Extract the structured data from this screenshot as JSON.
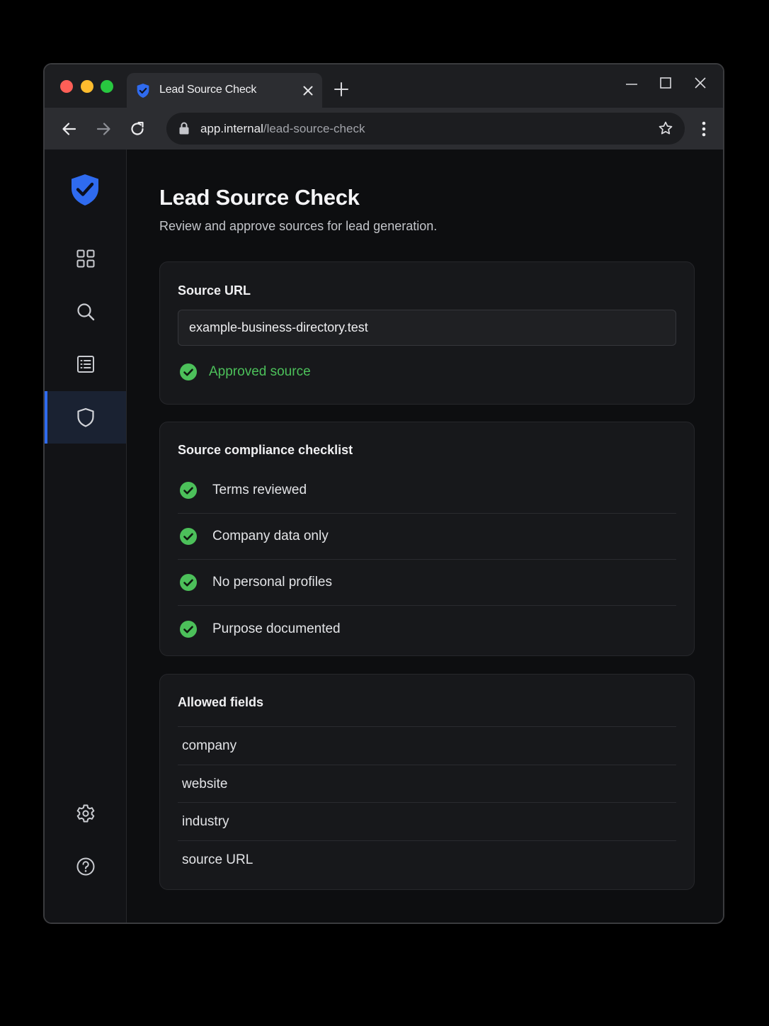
{
  "browser": {
    "tab": {
      "title": "Lead Source Check"
    },
    "address": {
      "host": "app.internal",
      "path": "/lead-source-check"
    }
  },
  "sidebar": {
    "items": [
      {
        "icon": "dashboard-grid-icon"
      },
      {
        "icon": "search-icon"
      },
      {
        "icon": "list-icon"
      },
      {
        "icon": "shield-icon",
        "active": true
      },
      {
        "icon": "gear-icon"
      },
      {
        "icon": "help-icon"
      }
    ]
  },
  "page": {
    "title": "Lead Source Check",
    "subtitle": "Review and approve sources for lead generation."
  },
  "source_url_card": {
    "title": "Source URL",
    "value": "example-business-directory.test",
    "status": "Approved source"
  },
  "checklist_card": {
    "title": "Source compliance checklist",
    "items": [
      {
        "label": "Terms reviewed",
        "checked": true
      },
      {
        "label": "Company data only",
        "checked": true
      },
      {
        "label": "No personal profiles",
        "checked": true
      },
      {
        "label": "Purpose documented",
        "checked": true
      }
    ]
  },
  "fields_card": {
    "title": "Allowed fields",
    "items": [
      "company",
      "website",
      "industry",
      "source URL"
    ]
  },
  "colors": {
    "accent_blue": "#2f6bef",
    "success_green": "#4cc05a",
    "background": "#0d0e10",
    "card": "#17181b"
  }
}
